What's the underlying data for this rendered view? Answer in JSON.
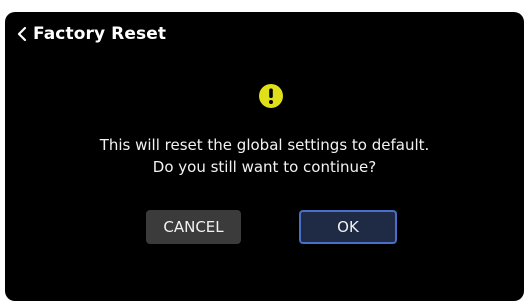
{
  "header": {
    "back_icon": "chevron-left-icon",
    "title": "Factory Reset"
  },
  "dialog": {
    "icon": "warning-icon",
    "icon_color": "#e0e01a",
    "message_line1": "This will reset the global settings to default.",
    "message_line2": "Do you still want to continue?",
    "cancel_label": "CANCEL",
    "ok_label": "OK",
    "ok_border_color": "#4a6fc9"
  }
}
